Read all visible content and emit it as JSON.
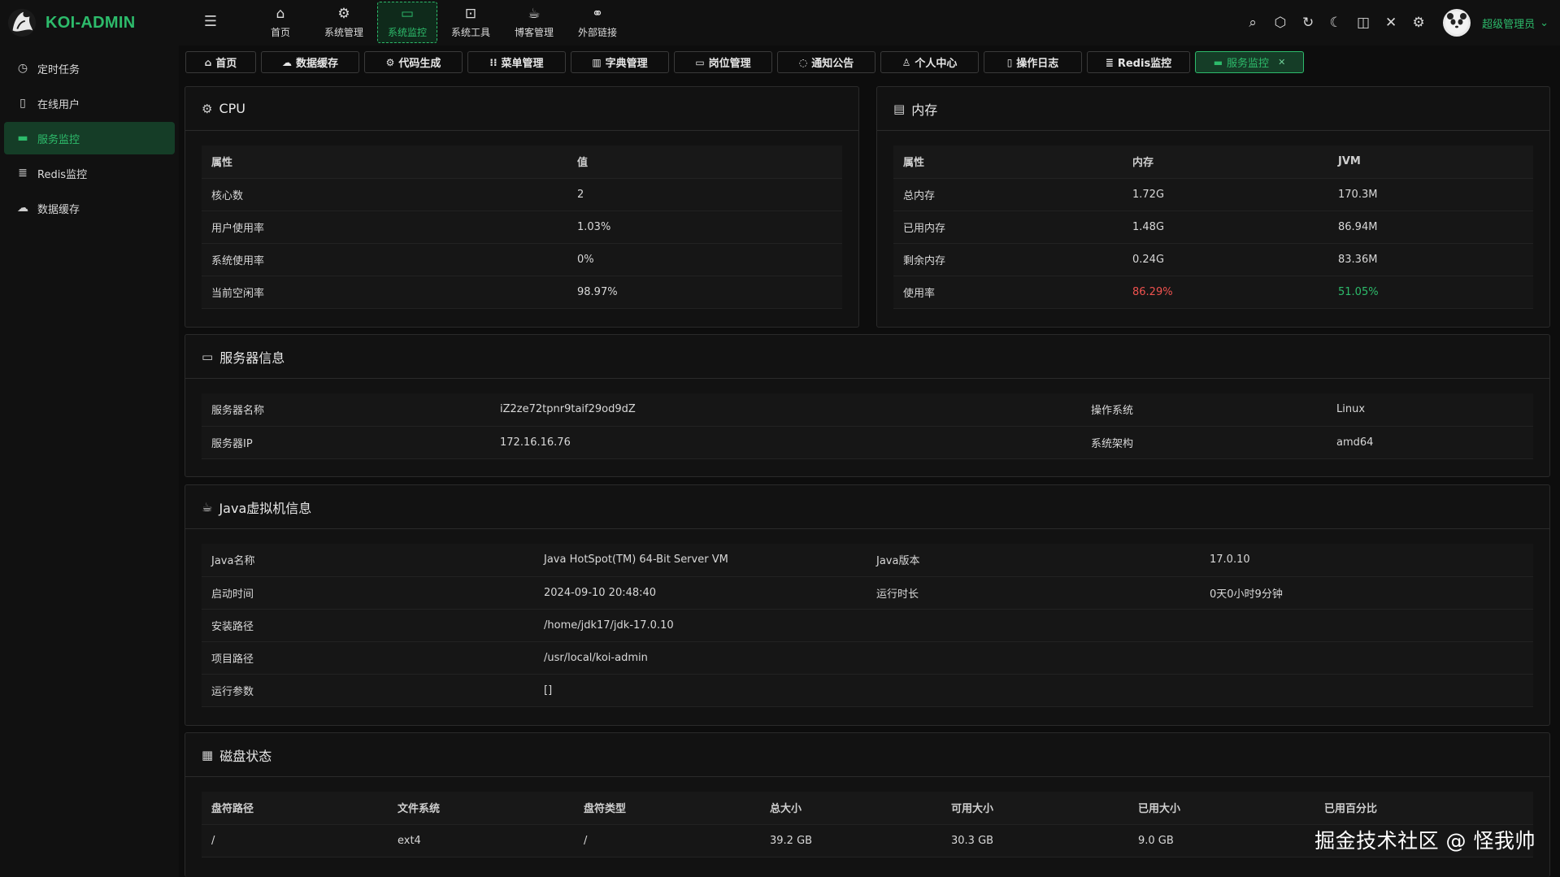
{
  "app": {
    "title": "KOI-ADMIN"
  },
  "topnav": [
    {
      "label": "首页",
      "icon": "home-icon",
      "glyph": "⌂"
    },
    {
      "label": "系统管理",
      "icon": "gear-icon",
      "glyph": "⚙"
    },
    {
      "label": "系统监控",
      "icon": "monitor-icon",
      "glyph": "▭"
    },
    {
      "label": "系统工具",
      "icon": "toolbox-icon",
      "glyph": "⊡"
    },
    {
      "label": "博客管理",
      "icon": "cup-icon",
      "glyph": "☕"
    },
    {
      "label": "外部链接",
      "icon": "link-icon",
      "glyph": "⚭"
    }
  ],
  "header": {
    "user_name": "超级管理员"
  },
  "sidebar": [
    {
      "label": "定时任务",
      "glyph": "◷"
    },
    {
      "label": "在线用户",
      "glyph": "▯"
    },
    {
      "label": "服务监控",
      "glyph": "▬"
    },
    {
      "label": "Redis监控",
      "glyph": "≣"
    },
    {
      "label": "数据缓存",
      "glyph": "☁"
    }
  ],
  "tabs": [
    {
      "label": "首页",
      "glyph": "⌂"
    },
    {
      "label": "数据缓存",
      "glyph": "☁"
    },
    {
      "label": "代码生成",
      "glyph": "⚙"
    },
    {
      "label": "菜单管理",
      "glyph": "⁝⁝"
    },
    {
      "label": "字典管理",
      "glyph": "▥"
    },
    {
      "label": "岗位管理",
      "glyph": "▭"
    },
    {
      "label": "通知公告",
      "glyph": "◌"
    },
    {
      "label": "个人中心",
      "glyph": "♙"
    },
    {
      "label": "操作日志",
      "glyph": "▯"
    },
    {
      "label": "Redis监控",
      "glyph": "≣"
    },
    {
      "label": "服务监控",
      "glyph": "▬"
    }
  ],
  "cpu": {
    "title": "CPU",
    "headers": [
      "属性",
      "值"
    ],
    "rows": [
      [
        "核心数",
        "2"
      ],
      [
        "用户使用率",
        "1.03%"
      ],
      [
        "系统使用率",
        "0%"
      ],
      [
        "当前空闲率",
        "98.97%"
      ]
    ]
  },
  "memory": {
    "title": "内存",
    "headers": [
      "属性",
      "内存",
      "JVM"
    ],
    "rows": [
      [
        "总内存",
        "1.72G",
        "170.3M"
      ],
      [
        "已用内存",
        "1.48G",
        "86.94M"
      ],
      [
        "剩余内存",
        "0.24G",
        "83.36M"
      ],
      [
        "使用率",
        "86.29%",
        "51.05%"
      ]
    ]
  },
  "server": {
    "title": "服务器信息",
    "rows": [
      [
        "服务器名称",
        "iZ2ze72tpnr9taif29od9dZ",
        "操作系统",
        "Linux"
      ],
      [
        "服务器IP",
        "172.16.16.76",
        "系统架构",
        "amd64"
      ]
    ]
  },
  "jvm": {
    "title": "Java虚拟机信息",
    "rows_pair": [
      [
        "Java名称",
        "Java HotSpot(TM) 64-Bit Server VM",
        "Java版本",
        "17.0.10"
      ],
      [
        "启动时间",
        "2024-09-10 20:48:40",
        "运行时长",
        "0天0小时9分钟"
      ]
    ],
    "rows_single": [
      [
        "安装路径",
        "/home/jdk17/jdk-17.0.10"
      ],
      [
        "项目路径",
        "/usr/local/koi-admin"
      ],
      [
        "运行参数",
        "[]"
      ]
    ]
  },
  "disk": {
    "title": "磁盘状态",
    "headers": [
      "盘符路径",
      "文件系统",
      "盘符类型",
      "总大小",
      "可用大小",
      "已用大小",
      "已用百分比"
    ],
    "rows": [
      [
        "/",
        "ext4",
        "/",
        "39.2 GB",
        "30.3 GB",
        "9.0 GB",
        ""
      ]
    ]
  },
  "watermark": "掘金技术社区 @ 怪我帅"
}
